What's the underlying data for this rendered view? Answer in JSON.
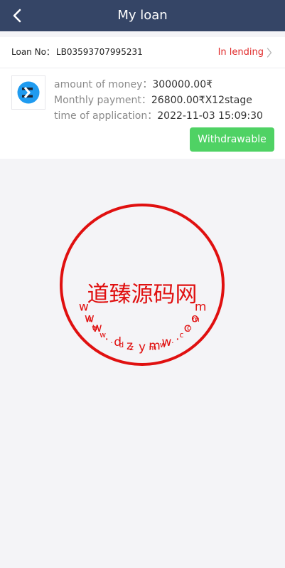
{
  "header": {
    "title": "My loan",
    "back_icon": "chevron-left-icon"
  },
  "loan": {
    "no_label": "Loan No：",
    "no_value": "LB03593707995231",
    "status": "In lending",
    "amount_label": "amount of money：",
    "amount_value": "300000.00₹",
    "monthly_label": "Monthly payment：",
    "monthly_value": "26800.00₹X12stage",
    "time_label": "time of application：",
    "time_value": "2022-11-03 15:09:30",
    "action_label": "Withdrawable"
  },
  "watermark": {
    "center_text": "道臻源码网",
    "top_arc": [
      "w",
      "w",
      "w",
      ".",
      "d",
      "z",
      "y",
      "m",
      "w",
      ".",
      "c",
      "o",
      "m"
    ],
    "bottom_arc": [
      "w",
      "w",
      "w",
      ".",
      "d",
      "z",
      "y",
      "m",
      "w",
      ".",
      "c",
      "o",
      "m"
    ]
  },
  "colors": {
    "header_bg": "#354566",
    "status": "#e02a2a",
    "button": "#4fd264",
    "stamp": "#e01010",
    "logo": "#1f9bf0"
  }
}
